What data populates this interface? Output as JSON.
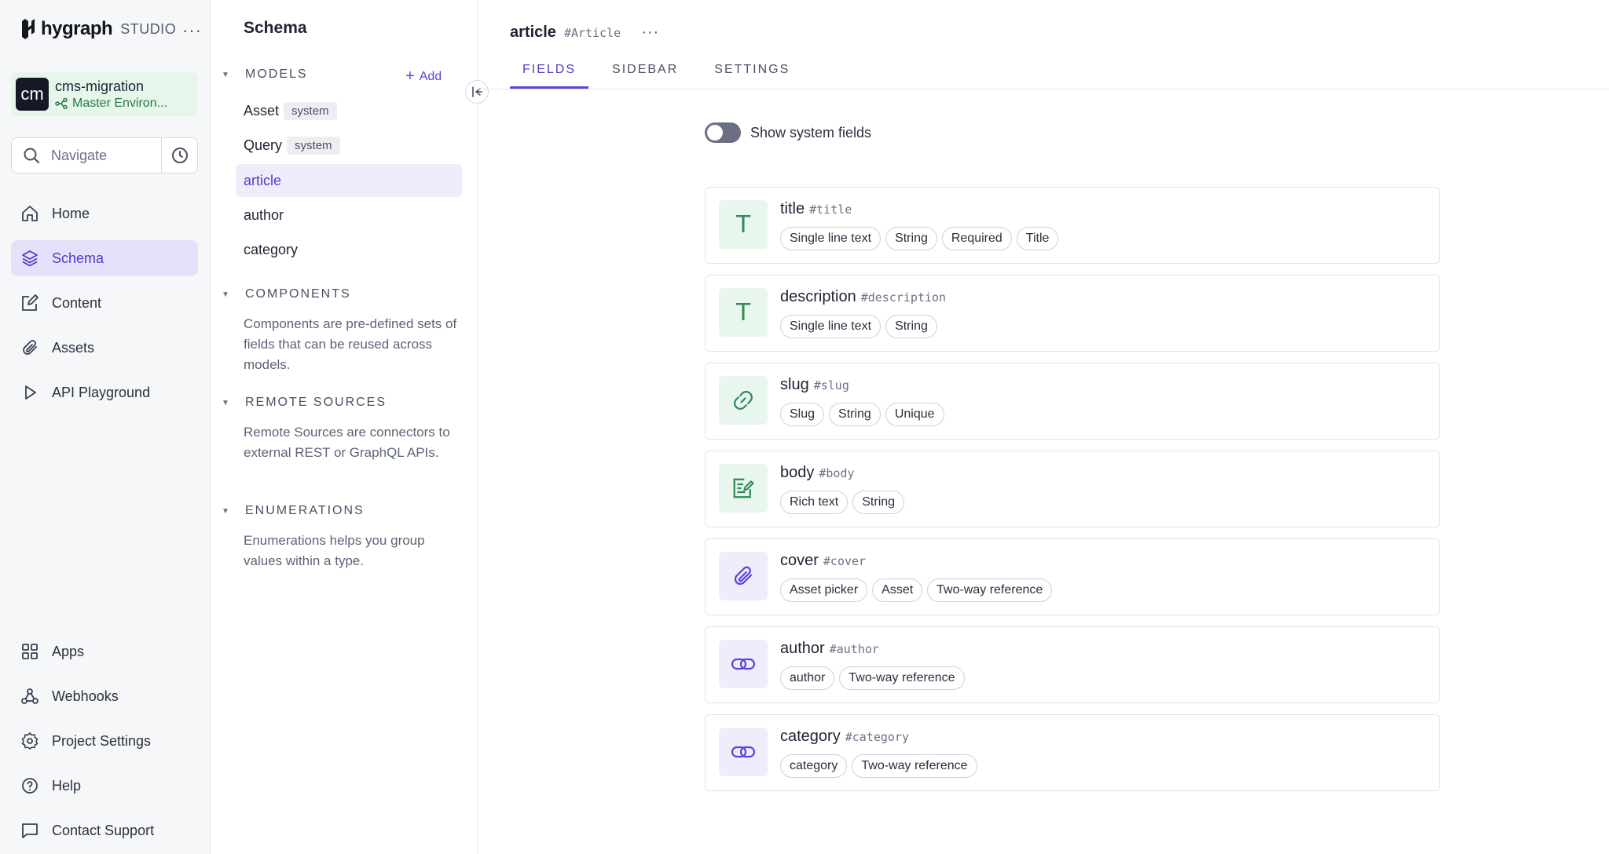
{
  "app": {
    "brand": "hygraph",
    "product": "STUDIO"
  },
  "project": {
    "avatar": "cm",
    "name": "cms-migration",
    "environment": "Master Environ..."
  },
  "navigate": {
    "placeholder": "Navigate"
  },
  "nav": {
    "top": [
      {
        "label": "Home",
        "icon": "home-icon"
      },
      {
        "label": "Schema",
        "icon": "layers-icon",
        "active": true
      },
      {
        "label": "Content",
        "icon": "edit-icon"
      },
      {
        "label": "Assets",
        "icon": "paperclip-icon"
      },
      {
        "label": "API Playground",
        "icon": "play-icon"
      }
    ],
    "bottom": [
      {
        "label": "Apps",
        "icon": "grid-icon"
      },
      {
        "label": "Webhooks",
        "icon": "webhook-icon"
      },
      {
        "label": "Project Settings",
        "icon": "settings-icon"
      },
      {
        "label": "Help",
        "icon": "help-icon"
      },
      {
        "label": "Contact Support",
        "icon": "message-icon"
      }
    ]
  },
  "schema": {
    "title": "Schema",
    "models_heading": "MODELS",
    "add_label": "Add",
    "models": [
      {
        "name": "Asset",
        "badge": "system"
      },
      {
        "name": "Query",
        "badge": "system"
      },
      {
        "name": "article",
        "active": true
      },
      {
        "name": "author"
      },
      {
        "name": "category"
      }
    ],
    "components_heading": "COMPONENTS",
    "components_desc": "Components are pre-defined sets of fields that can be reused across models.",
    "remote_heading": "REMOTE SOURCES",
    "remote_desc": "Remote Sources are connectors to external REST or GraphQL APIs.",
    "enum_heading": "ENUMERATIONS",
    "enum_desc": "Enumerations helps you group values within a type."
  },
  "model": {
    "name": "article",
    "api_id": "#Article"
  },
  "tabs": [
    "FIELDS",
    "SIDEBAR",
    "SETTINGS"
  ],
  "active_tab": "FIELDS",
  "system_fields": {
    "label": "Show system fields",
    "on": false
  },
  "fields": [
    {
      "name": "title",
      "api_id": "#title",
      "icon": "text-icon",
      "chips": [
        "Single line text",
        "String",
        "Required",
        "Title"
      ]
    },
    {
      "name": "description",
      "api_id": "#description",
      "icon": "text-icon",
      "chips": [
        "Single line text",
        "String"
      ]
    },
    {
      "name": "slug",
      "api_id": "#slug",
      "icon": "link-icon",
      "chips": [
        "Slug",
        "String",
        "Unique"
      ]
    },
    {
      "name": "body",
      "api_id": "#body",
      "icon": "rich-text-icon",
      "chips": [
        "Rich text",
        "String"
      ]
    },
    {
      "name": "cover",
      "api_id": "#cover",
      "icon": "paperclip-icon",
      "chips": [
        "Asset picker",
        "Asset",
        "Two-way reference"
      ]
    },
    {
      "name": "author",
      "api_id": "#author",
      "icon": "reference-icon",
      "chips": [
        "author",
        "Two-way reference"
      ]
    },
    {
      "name": "category",
      "api_id": "#category",
      "icon": "reference-icon",
      "chips": [
        "category",
        "Two-way reference"
      ]
    }
  ],
  "colors": {
    "accent": "#5b45d6",
    "active_bg": "#e5e1fb",
    "env_green": "#237a42"
  }
}
